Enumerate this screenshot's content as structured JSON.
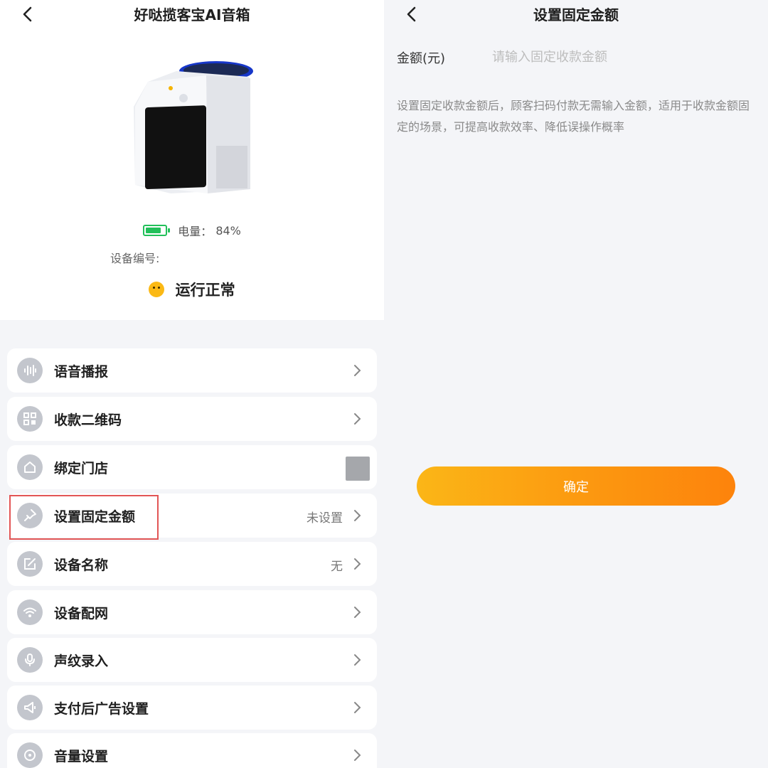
{
  "left_screen": {
    "title": "好哒揽客宝AI音箱",
    "battery": {
      "label": "电量：",
      "value": "84%",
      "level": 0.84,
      "color": "#22c05a"
    },
    "device_no_label": "设备编号:",
    "status_text": "运行正常",
    "menu": [
      {
        "id": "voice",
        "label": "语音播报",
        "value": "",
        "icon": "sound-wave-icon"
      },
      {
        "id": "qrcode",
        "label": "收款二维码",
        "value": "",
        "icon": "qr-code-icon"
      },
      {
        "id": "store",
        "label": "绑定门店",
        "value": "",
        "icon": "home-icon"
      },
      {
        "id": "fixed_amount",
        "label": "设置固定金额",
        "value": "未设置",
        "icon": "pin-icon"
      },
      {
        "id": "device_name",
        "label": "设备名称",
        "value": "无",
        "icon": "edit-icon"
      },
      {
        "id": "network",
        "label": "设备配网",
        "value": "",
        "icon": "wifi-icon"
      },
      {
        "id": "voiceprint",
        "label": "声纹录入",
        "value": "",
        "icon": "microphone-icon"
      },
      {
        "id": "ad",
        "label": "支付后广告设置",
        "value": "",
        "icon": "megaphone-icon"
      },
      {
        "id": "volume",
        "label": "音量设置",
        "value": "",
        "icon": "volume-icon"
      }
    ]
  },
  "right_screen": {
    "title": "设置固定金额",
    "amount_label": "金额(元)",
    "amount_placeholder": "请输入固定收款金额",
    "amount_value": "",
    "description": "设置固定收款金额后，顾客扫码付款无需输入金额，适用于收款金额固定的场景，可提高收款效率、降低误操作概率",
    "confirm_label": "确定"
  },
  "colors": {
    "accent_orange_start": "#fbb617",
    "accent_orange_end": "#fd830c",
    "highlight_red": "#e25555",
    "status_yellow": "#fbb915"
  }
}
